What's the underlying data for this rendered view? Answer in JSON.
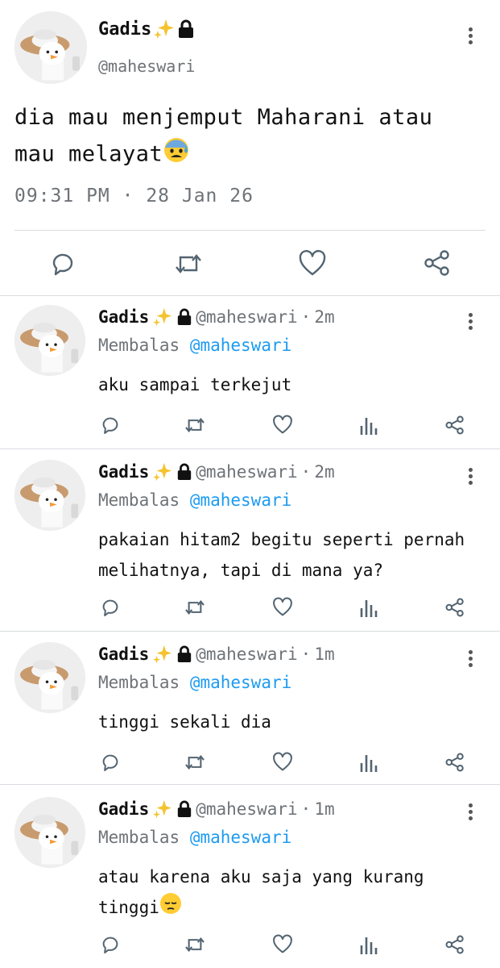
{
  "tweet": {
    "display_name": "Gadis",
    "handle": "@maheswari",
    "text": "dia mau menjemput Maharani atau mau melayat",
    "text_emoji": "anxious-face-with-sweat",
    "timestamp": "09:31 PM · 28 Jan 26",
    "badges": [
      "sparkles-icon",
      "lock-icon"
    ],
    "actions": [
      "reply-icon",
      "retweet-icon",
      "like-icon",
      "share-icon"
    ]
  },
  "replies": [
    {
      "display_name": "Gadis",
      "handle": "@maheswari",
      "time": "2m",
      "replying_label": "Membalas",
      "replying_to": "@maheswari",
      "text": "aku sampai terkejut"
    },
    {
      "display_name": "Gadis",
      "handle": "@maheswari",
      "time": "2m",
      "replying_label": "Membalas",
      "replying_to": "@maheswari",
      "text": "pakaian hitam2 begitu seperti pernah melihatnya, tapi di mana ya?"
    },
    {
      "display_name": "Gadis",
      "handle": "@maheswari",
      "time": "1m",
      "replying_label": "Membalas",
      "replying_to": "@maheswari",
      "text": "tinggi sekali dia"
    },
    {
      "display_name": "Gadis",
      "handle": "@maheswari",
      "time": "1m",
      "replying_label": "Membalas",
      "replying_to": "@maheswari",
      "text": "atau karena aku saja yang kurang tinggi",
      "text_emoji": "pensive-face"
    }
  ],
  "colors": {
    "text": "#111111",
    "secondary": "#6e7378",
    "mention": "#1d9bf0",
    "divider": "#d8dde1",
    "icon": "#536471"
  }
}
